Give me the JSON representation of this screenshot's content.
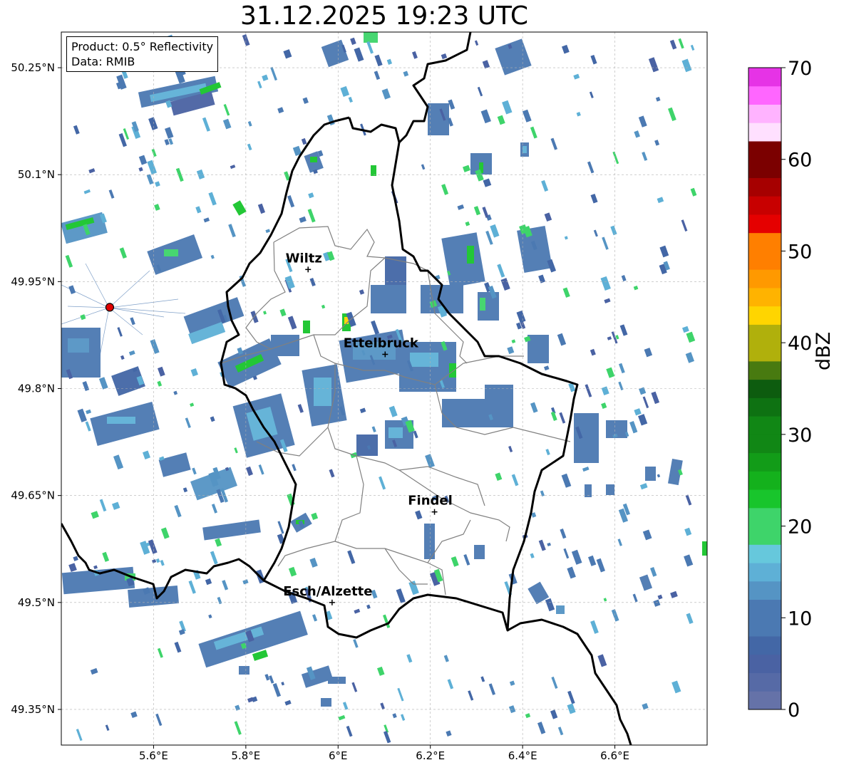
{
  "title": "31.12.2025 19:23 UTC",
  "info_box": {
    "product": "Product: 0.5° Reflectivity",
    "data_source": "Data: RMIB"
  },
  "map": {
    "lon_range": [
      5.4,
      6.8
    ],
    "lat_range": [
      49.3,
      50.3
    ],
    "x_ticks": [
      {
        "value": 5.6,
        "label": "5.6°E"
      },
      {
        "value": 5.8,
        "label": "5.8°E"
      },
      {
        "value": 6.0,
        "label": "6°E"
      },
      {
        "value": 6.2,
        "label": "6.2°E"
      },
      {
        "value": 6.4,
        "label": "6.4°E"
      },
      {
        "value": 6.6,
        "label": "6.6°E"
      }
    ],
    "y_ticks": [
      {
        "value": 50.25,
        "label": "50.25°N"
      },
      {
        "value": 50.1,
        "label": "50.1°N"
      },
      {
        "value": 49.95,
        "label": "49.95°N"
      },
      {
        "value": 49.8,
        "label": "49.8°N"
      },
      {
        "value": 49.65,
        "label": "49.65°N"
      },
      {
        "value": 49.5,
        "label": "49.5°N"
      },
      {
        "value": 49.35,
        "label": "49.35°N"
      }
    ],
    "cities": [
      {
        "name": "Wiltz",
        "lon": 5.935,
        "lat": 49.967
      },
      {
        "name": "Ettelbruck",
        "lon": 6.102,
        "lat": 49.848
      },
      {
        "name": "Findel",
        "lon": 6.209,
        "lat": 49.627
      },
      {
        "name": "Esch/Alzette",
        "lon": 5.987,
        "lat": 49.5
      }
    ],
    "radar_site": {
      "name": "Radar",
      "lon": 5.505,
      "lat": 49.914
    },
    "grid": true
  },
  "colorbar": {
    "label": "dBZ",
    "min": 0,
    "max": 70,
    "ticks": [
      {
        "value": 0,
        "label": "0"
      },
      {
        "value": 10,
        "label": "10"
      },
      {
        "value": 20,
        "label": "20"
      },
      {
        "value": 30,
        "label": "30"
      },
      {
        "value": 40,
        "label": "40"
      },
      {
        "value": 50,
        "label": "50"
      },
      {
        "value": 60,
        "label": "60"
      },
      {
        "value": 70,
        "label": "70"
      }
    ],
    "colors": [
      "#6572a8",
      "#566aa6",
      "#4a62a3",
      "#4367a6",
      "#4b79b2",
      "#5594c4",
      "#5eb0d6",
      "#66c8dc",
      "#3ed46a",
      "#18c52c",
      "#14b11c",
      "#129c18",
      "#118715",
      "#0e7212",
      "#0d5c0f",
      "#487a10",
      "#b0b00c",
      "#ffd500",
      "#ffb300",
      "#ff9900",
      "#ff7f00",
      "#e50000",
      "#c80000",
      "#a60000",
      "#7b0000",
      "#ffe0ff",
      "#ffb3ff",
      "#ff66ff",
      "#e633e6"
    ]
  }
}
